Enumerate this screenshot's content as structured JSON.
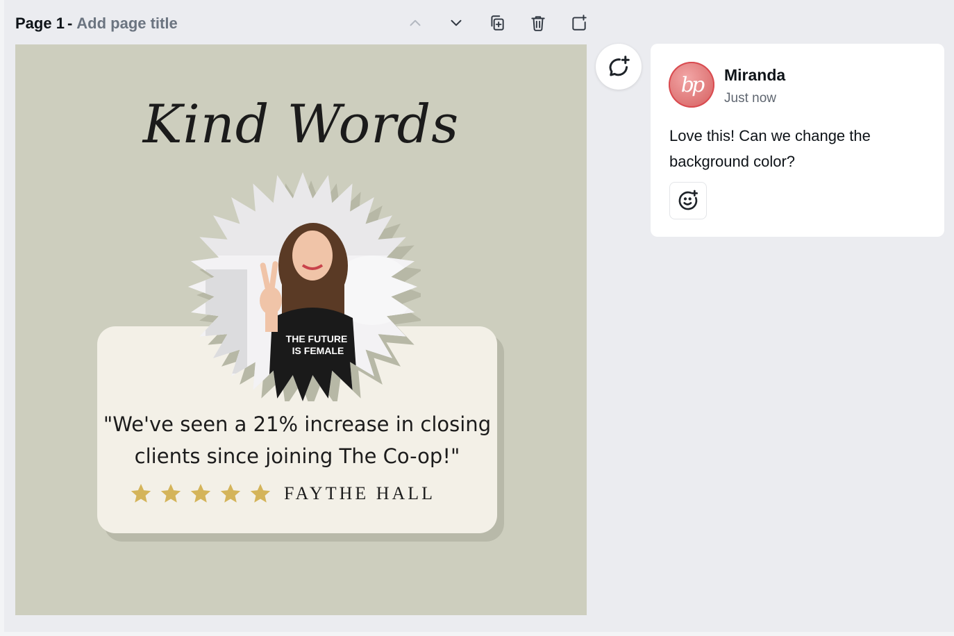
{
  "page_header": {
    "page_label": "Page 1",
    "separator": "-",
    "title_placeholder": "Add page title"
  },
  "toolbar": {
    "buttons": [
      {
        "icon": "chevron-up-icon",
        "label": "Move page up",
        "enabled": false
      },
      {
        "icon": "chevron-down-icon",
        "label": "Move page down",
        "enabled": true
      },
      {
        "icon": "duplicate-page-icon",
        "label": "Duplicate page",
        "enabled": true
      },
      {
        "icon": "trash-icon",
        "label": "Delete page",
        "enabled": true
      },
      {
        "icon": "add-page-icon",
        "label": "Add page",
        "enabled": true
      }
    ]
  },
  "design": {
    "script_title": "Kind Words",
    "photo_shirt_text_line1": "THE FUTURE",
    "photo_shirt_text_line2": "IS FEMALE",
    "quote_line1": "\"We've seen a 21% increase in closing",
    "quote_line2": "clients since joining The Co-op!\"",
    "rating": 5,
    "rating_max": 5,
    "author": "FAYTHE HALL",
    "colors": {
      "background": "#cdcebe",
      "card": "#f3f0e7",
      "card_shadow": "#b8b9a9",
      "star": "#d4b45a"
    }
  },
  "comment_button": {
    "icon": "add-comment-icon",
    "label": "Add comment"
  },
  "comment": {
    "author": "Miranda",
    "avatar_initials": "bp",
    "time": "Just now",
    "text": "Love this! Can we change the background color?",
    "reaction_icon": "add-reaction-icon"
  }
}
